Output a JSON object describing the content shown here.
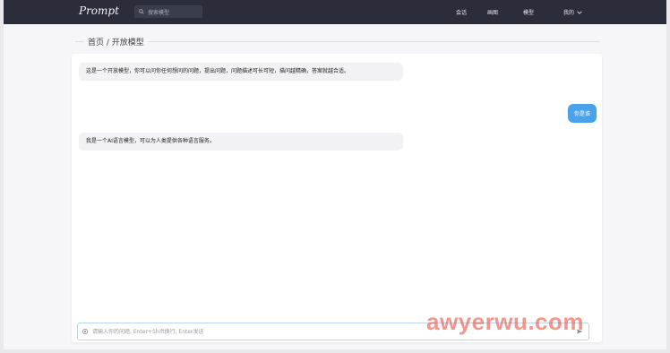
{
  "header": {
    "logo": "Prompt",
    "search_placeholder": "搜索模型",
    "nav": [
      "会话",
      "画图",
      "模型",
      "我的"
    ]
  },
  "breadcrumb": "首页 / 开放模型",
  "messages": [
    {
      "role": "assistant",
      "text": "这是一个开放模型，你可以问你任何想问的问题，提出问题，问题描述可长可短，描问越精确，答案就越合适。"
    },
    {
      "role": "user",
      "text": "你是谁"
    },
    {
      "role": "assistant",
      "text": "我是一个AI语言模型，可以为人类提供各种语言服务。"
    }
  ],
  "composer": {
    "placeholder": "请输入你的问题, Enter+Shift换行, Enter发送"
  },
  "watermark": "awyerwu.com",
  "colors": {
    "topbar": "#2b2d3a",
    "user_bubble": "#4aa3ea",
    "assistant_bubble": "#f2f2f4"
  }
}
